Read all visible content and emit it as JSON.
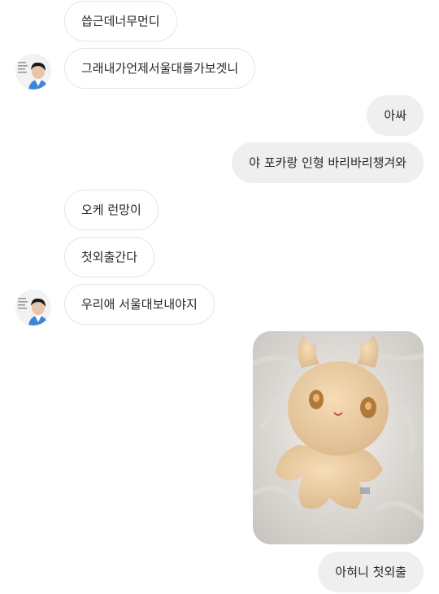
{
  "messages": [
    {
      "id": "m1",
      "side": "in",
      "text": "씁근데너무먼디"
    },
    {
      "id": "m2",
      "side": "in",
      "text": "그래내가언제서울대를가보겟니",
      "avatar": true
    },
    {
      "id": "m3",
      "side": "out",
      "text": "아싸"
    },
    {
      "id": "m4",
      "side": "out",
      "text": "야 포카랑 인형 바리바리챙겨와"
    },
    {
      "id": "m5",
      "side": "in",
      "text": "오케 런망이"
    },
    {
      "id": "m6",
      "side": "in",
      "text": "첫외출간다"
    },
    {
      "id": "m7",
      "side": "in",
      "text": "우리애 서울대보내야지",
      "avatar": true
    },
    {
      "id": "m8",
      "side": "out",
      "type": "photo",
      "icon": "plush-toy-photo"
    },
    {
      "id": "m9",
      "side": "out",
      "text": "아혀니 첫외출"
    }
  ],
  "colors": {
    "incoming_border": "#e5e5e5",
    "outgoing_bg": "#efefef",
    "text": "#262626"
  }
}
